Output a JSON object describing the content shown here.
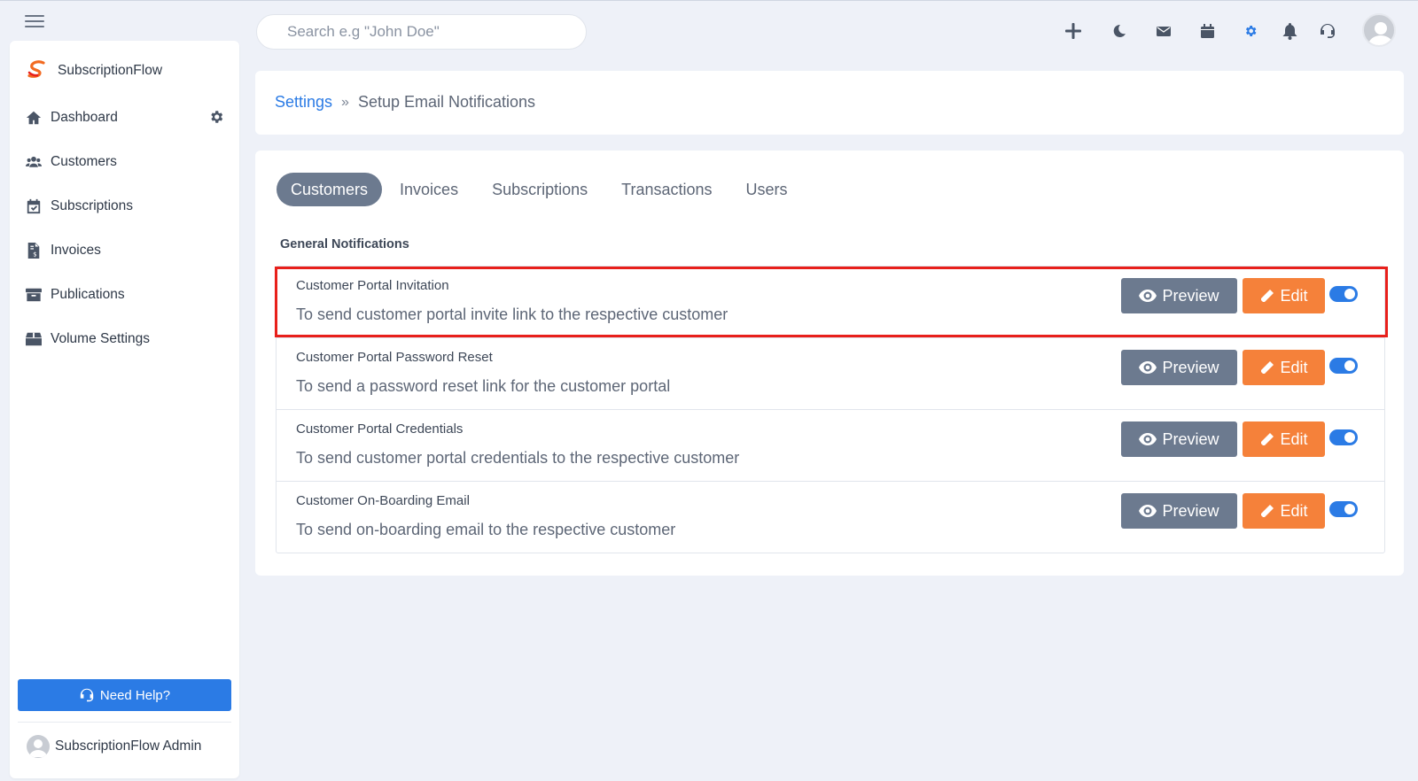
{
  "search": {
    "placeholder": "Search e.g \"John Doe\""
  },
  "brand": {
    "name": "SubscriptionFlow"
  },
  "sidebar": {
    "items": [
      {
        "label": "Dashboard",
        "icon": "home-icon"
      },
      {
        "label": "Customers",
        "icon": "users-icon"
      },
      {
        "label": "Subscriptions",
        "icon": "calendar-check-icon"
      },
      {
        "label": "Invoices",
        "icon": "invoice-icon"
      },
      {
        "label": "Publications",
        "icon": "archive-icon"
      },
      {
        "label": "Volume Settings",
        "icon": "box-icon"
      }
    ],
    "help_label": "Need Help?",
    "admin_name": "SubscriptionFlow Admin"
  },
  "topbar": {
    "icons": [
      "plus-icon",
      "moon-icon",
      "envelope-icon",
      "calendar-icon",
      "gear-icon",
      "bell-icon",
      "headset-icon",
      "user-avatar"
    ]
  },
  "breadcrumb": {
    "parent": "Settings",
    "separator": "»",
    "current": "Setup Email Notifications"
  },
  "tabs": [
    {
      "label": "Customers",
      "active": true
    },
    {
      "label": "Invoices",
      "active": false
    },
    {
      "label": "Subscriptions",
      "active": false
    },
    {
      "label": "Transactions",
      "active": false
    },
    {
      "label": "Users",
      "active": false
    }
  ],
  "section_title": "General Notifications",
  "notifications": [
    {
      "title": "Customer Portal Invitation",
      "description": "To send customer portal invite link to the respective customer",
      "enabled": true
    },
    {
      "title": "Customer Portal Password Reset",
      "description": "To send a password reset link for the customer portal",
      "enabled": true
    },
    {
      "title": "Customer Portal Credentials",
      "description": "To send customer portal credentials to the respective customer",
      "enabled": true
    },
    {
      "title": "Customer On-Boarding Email",
      "description": "To send on-boarding email to the respective customer",
      "enabled": true
    }
  ],
  "buttons": {
    "preview_label": "Preview",
    "edit_label": "Edit"
  },
  "colors": {
    "accent": "#2b7be5",
    "edit": "#f5813a",
    "preview": "#6c7a8f",
    "highlight": "#e8201b",
    "active_top_icon": "#2b7be5"
  }
}
